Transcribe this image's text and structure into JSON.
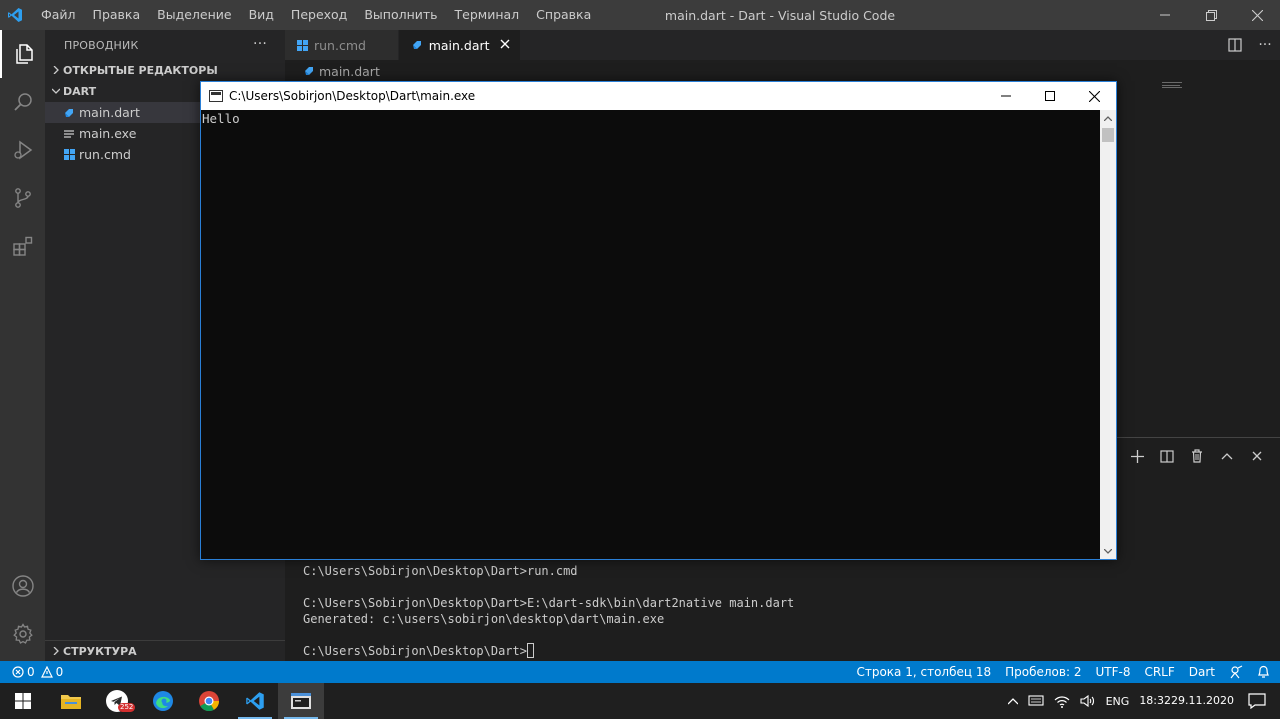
{
  "titlebar": {
    "menu": [
      "Файл",
      "Правка",
      "Выделение",
      "Вид",
      "Переход",
      "Выполнить",
      "Терминал",
      "Справка"
    ],
    "window_title": "main.dart - Dart - Visual Studio Code"
  },
  "sidebar": {
    "header": "ПРОВОДНИК",
    "more": "···",
    "open_editors": "ОТКРЫТЫЕ РЕДАКТОРЫ",
    "folder": "DART",
    "files": [
      "main.dart",
      "main.exe",
      "run.cmd"
    ],
    "outline": "СТРУКТУРА"
  },
  "tabs": [
    {
      "label": "run.cmd",
      "active": false
    },
    {
      "label": "main.dart",
      "active": true
    }
  ],
  "breadcrumb": "main.dart",
  "terminal": {
    "lines": [
      "C:\\Users\\Sobirjon\\Desktop\\Dart>run.cmd",
      "",
      "C:\\Users\\Sobirjon\\Desktop\\Dart>E:\\dart-sdk\\bin\\dart2native main.dart",
      "Generated: c:\\users\\sobirjon\\desktop\\dart\\main.exe",
      "",
      "C:\\Users\\Sobirjon\\Desktop\\Dart>"
    ]
  },
  "console": {
    "title": "C:\\Users\\Sobirjon\\Desktop\\Dart\\main.exe",
    "output": "Hello"
  },
  "statusbar": {
    "errors": "0",
    "warnings": "0",
    "position": "Строка 1, столбец 18",
    "spaces": "Пробелов: 2",
    "encoding": "UTF-8",
    "eol": "CRLF",
    "language": "Dart"
  },
  "taskbar": {
    "telegram_badge": "252",
    "lang": "ENG",
    "time": "18:32",
    "date": "29.11.2020"
  },
  "colors": {
    "statusbar": "#007acc",
    "activitybar": "#333333",
    "sidebar": "#252526",
    "editor": "#1e1e1e",
    "dart_icon": "#42a5f5"
  }
}
